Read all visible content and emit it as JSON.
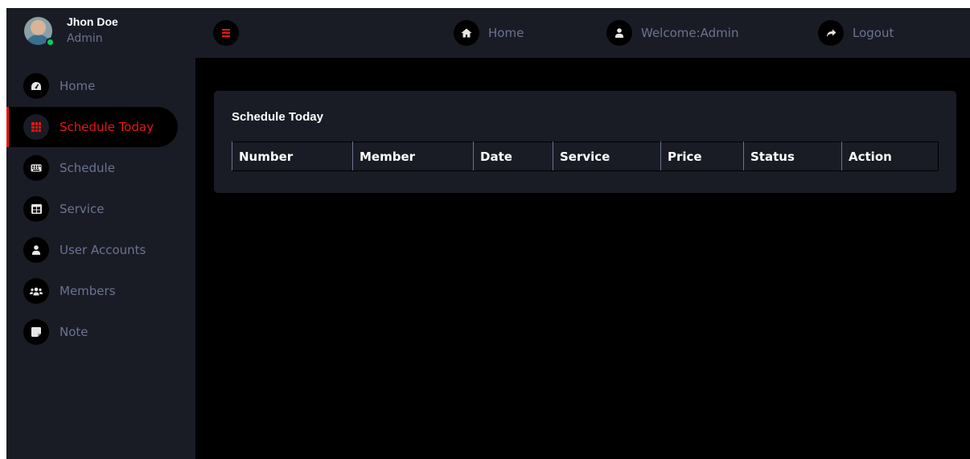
{
  "profile": {
    "name": "Jhon Doe",
    "role": "Admin"
  },
  "sidebar": {
    "items": [
      {
        "label": "Home",
        "icon": "dashboard-gauge-icon",
        "active": false
      },
      {
        "label": "Schedule Today",
        "icon": "grid-table-icon",
        "active": true
      },
      {
        "label": "Schedule",
        "icon": "keyboard-icon",
        "active": false
      },
      {
        "label": "Service",
        "icon": "table-icon",
        "active": false
      },
      {
        "label": "User Accounts",
        "icon": "user-icon",
        "active": false
      },
      {
        "label": "Members",
        "icon": "users-group-icon",
        "active": false
      },
      {
        "label": "Note",
        "icon": "sticky-note-icon",
        "active": false
      }
    ]
  },
  "topbar": {
    "home_label": "Home",
    "welcome_label": "Welcome:Admin",
    "logout_label": "Logout"
  },
  "main": {
    "card_title": "Schedule Today",
    "table": {
      "columns": [
        "Number",
        "Member",
        "Date",
        "Service",
        "Price",
        "Status",
        "Action"
      ],
      "rows": []
    }
  },
  "colors": {
    "accent": "#eb1616",
    "panel": "#191c24",
    "background": "#000000",
    "muted_text": "#6c7293"
  }
}
